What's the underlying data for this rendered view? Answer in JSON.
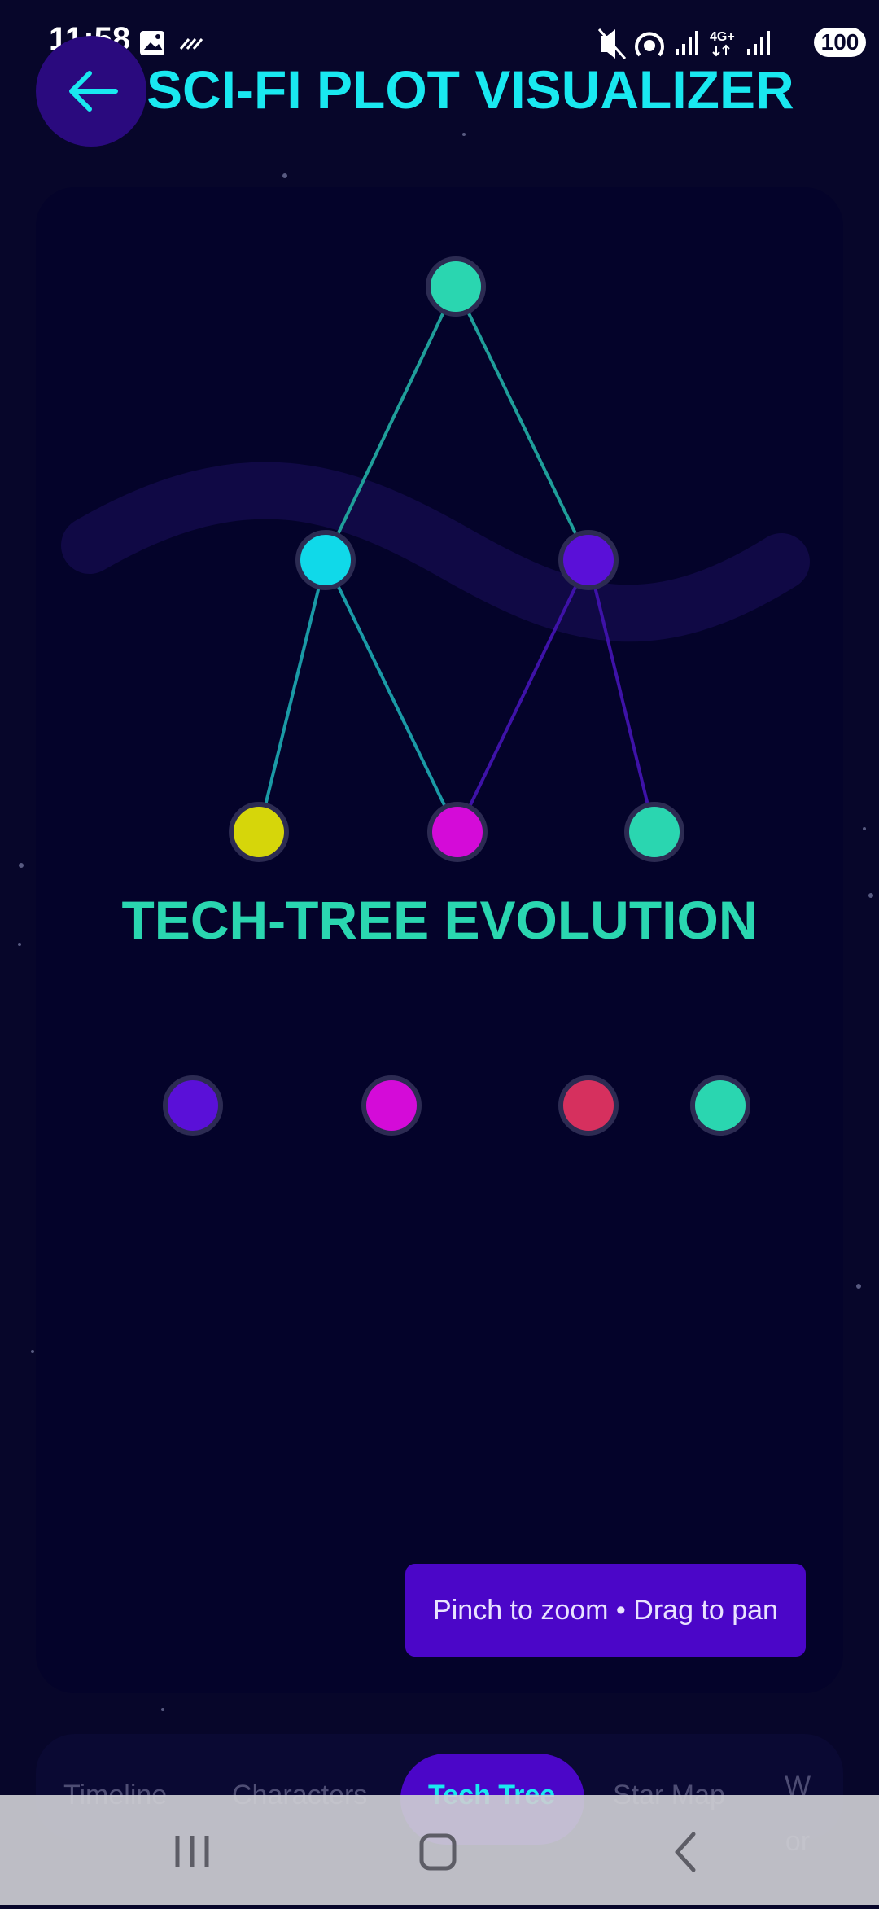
{
  "status_bar": {
    "time": "11:58",
    "battery": "100",
    "network_label": "4G+"
  },
  "header": {
    "title": "SCI-FI PLOT VISUALIZER"
  },
  "tech_tree": {
    "title": "TECH-TREE EVOLUTION",
    "node_colors": [
      "#2ad6b0",
      "#10d9e9",
      "#5a10d8",
      "#d6d60a",
      "#d40bd8",
      "#d6305e"
    ]
  },
  "hint": "Pinch to zoom • Drag to pan",
  "tabs": [
    {
      "label": "Timeline",
      "active": false
    },
    {
      "label": "Characters",
      "active": false
    },
    {
      "label": "Tech Tree",
      "active": true
    },
    {
      "label": "Star Map",
      "active": false
    }
  ],
  "tab_more": {
    "line1": "W",
    "line2": "or"
  },
  "colors": {
    "accent": "#19e8f0",
    "background": "#07062a",
    "panel": "#04032a",
    "active_tab": "#4b06c8"
  }
}
